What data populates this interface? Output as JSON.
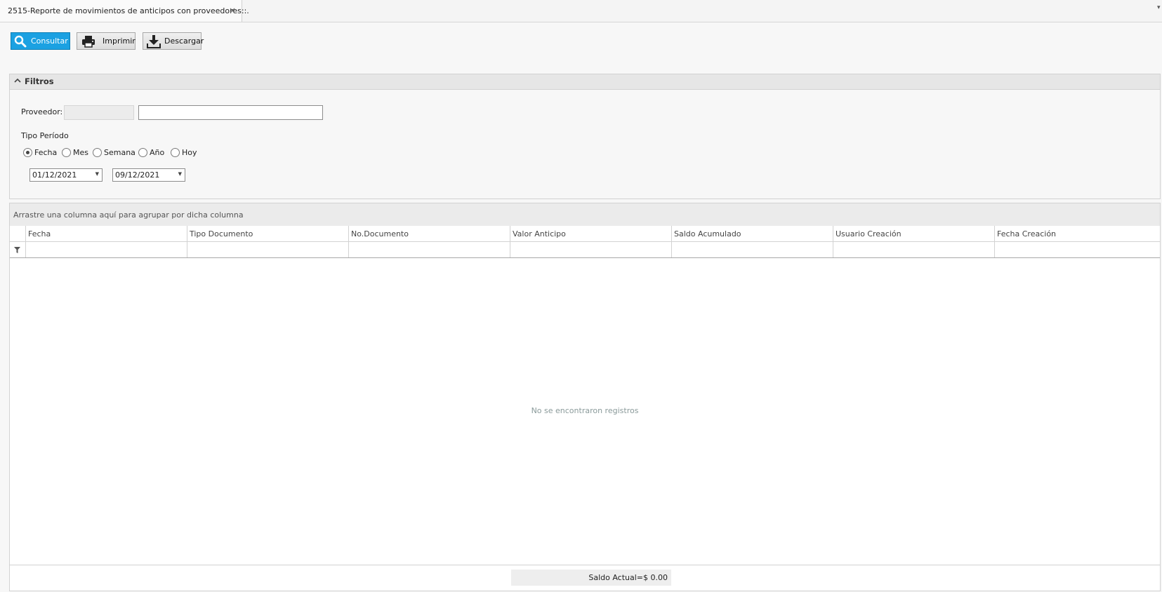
{
  "tab": {
    "title": "2515-Reporte de  movimientos de anticipos con proveedores::.",
    "close_glyph": "×",
    "overflow_glyph": "▾"
  },
  "toolbar": {
    "consultar_label": "Consultar",
    "consultar_icon": "search-icon",
    "imprimir_label": "Imprimir",
    "imprimir_icon": "printer-icon",
    "descargar_label": "Descargar",
    "descargar_icon": "download-icon"
  },
  "filters": {
    "title": "Filtros",
    "proveedor_label": "Proveedor:",
    "proveedor_code": "",
    "proveedor_name": "",
    "tipo_periodo_label": "Tipo Período",
    "period_options": [
      {
        "label": "Fecha",
        "checked": true
      },
      {
        "label": "Mes",
        "checked": false
      },
      {
        "label": "Semana",
        "checked": false
      },
      {
        "label": "Año",
        "checked": false
      },
      {
        "label": "Hoy",
        "checked": false
      }
    ],
    "date_from": "01/12/2021",
    "date_to": "09/12/2021"
  },
  "grid": {
    "group_panel_text": "Arrastre una columna aquí para agrupar por dicha columna",
    "columns": [
      "Fecha",
      "Tipo Documento",
      "No.Documento",
      "Valor Anticipo",
      "Saldo Acumulado",
      "Usuario Creación",
      "Fecha Creación"
    ],
    "empty_message": "No se encontraron registros",
    "summary": "Saldo Actual=$ 0.00"
  },
  "colors": {
    "primary_button": "#1ba1e2",
    "background": "#f7f7f7"
  }
}
